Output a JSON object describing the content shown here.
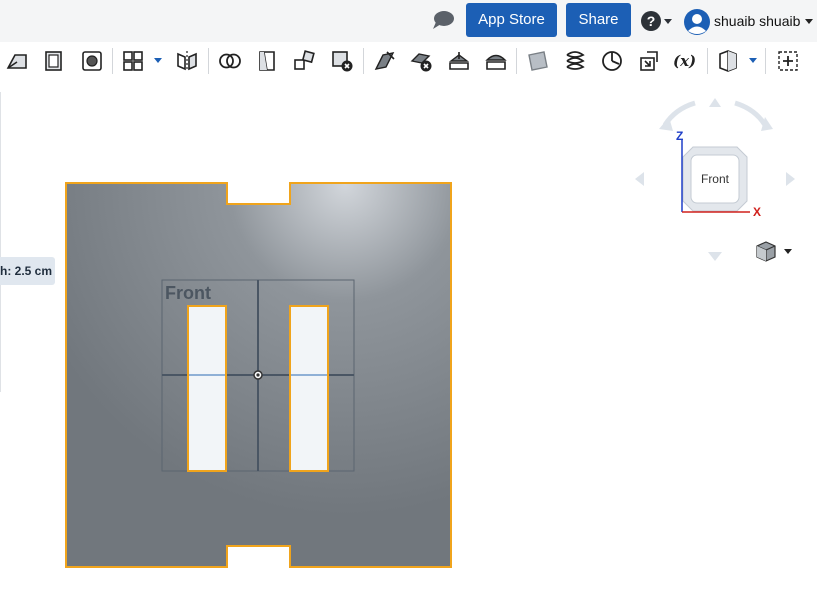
{
  "header": {
    "chat_icon": "comment-icon",
    "app_store_label": "App Store",
    "share_label": "Share",
    "help_icon": "question-circle-icon",
    "user": {
      "name": "shuaib shuaib",
      "avatar_icon": "user-avatar-icon"
    }
  },
  "toolbar": {
    "tools": [
      {
        "name": "sketch-tool-icon"
      },
      {
        "name": "extrude-icon"
      },
      {
        "name": "revolve-icon"
      },
      {
        "name": "pattern-icon",
        "dropdown": true
      },
      {
        "name": "mirror-icon"
      },
      {
        "name": "boolean-icon"
      },
      {
        "name": "split-icon"
      },
      {
        "name": "transform-icon"
      },
      {
        "name": "delete-part-icon"
      },
      {
        "name": "modify-face-icon"
      },
      {
        "name": "delete-face-icon"
      },
      {
        "name": "move-face-icon"
      },
      {
        "name": "replace-face-icon"
      },
      {
        "name": "plane-icon"
      },
      {
        "name": "helix-icon"
      },
      {
        "name": "mate-connector-icon"
      },
      {
        "name": "import-icon"
      },
      {
        "name": "variable-icon",
        "label": "(x)"
      },
      {
        "name": "section-view-icon",
        "dropdown": true
      },
      {
        "name": "add-tool-icon"
      }
    ]
  },
  "viewport": {
    "dimension_tag": "h: 2.5 cm",
    "plane_label": "Front",
    "view_cube": {
      "face_label": "Front",
      "axis_z": "Z",
      "axis_x": "X"
    },
    "render_mode_icon": "shaded-cube-icon",
    "colors": {
      "part_fill": "#7a8086",
      "edge_highlight": "#f0a41c",
      "axis_x": "#d0201c",
      "axis_z": "#1f3fc8",
      "accent": "#1c5fb5"
    }
  }
}
